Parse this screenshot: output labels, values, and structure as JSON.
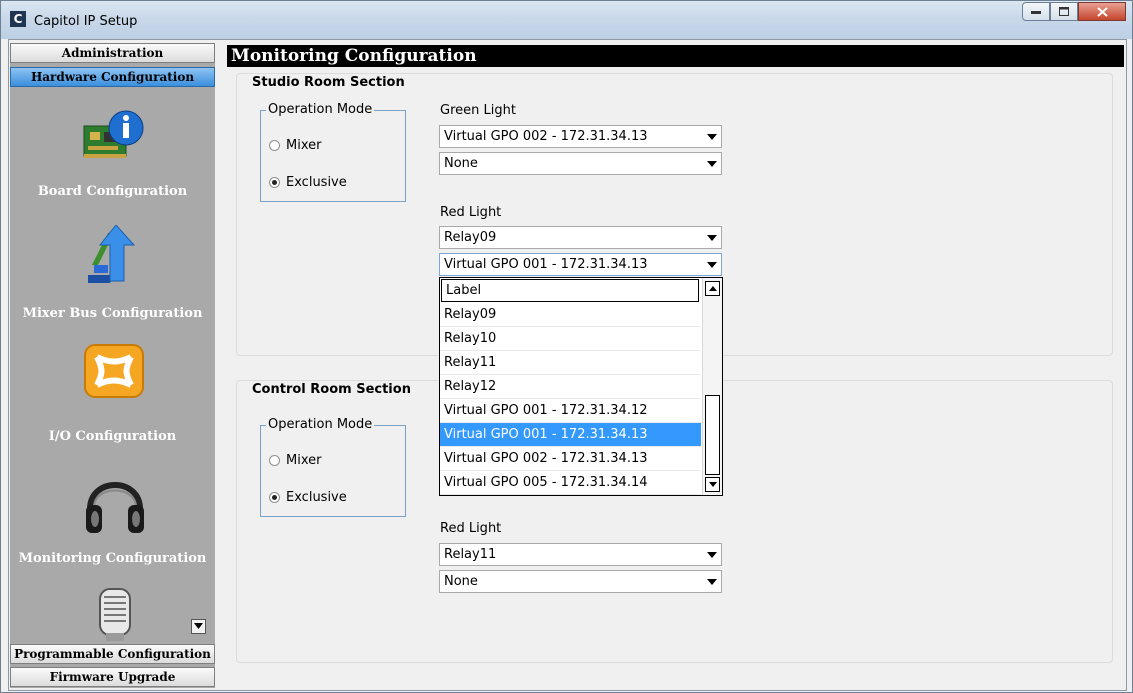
{
  "window": {
    "title": "Capitol IP Setup",
    "icon": "C"
  },
  "sidebar": {
    "top_buttons": [
      {
        "label": "Administration"
      },
      {
        "label": "Hardware Configuration"
      }
    ],
    "items": [
      {
        "label": "Board Configuration",
        "icon": "board-icon"
      },
      {
        "label": "Mixer Bus Configuration",
        "icon": "mixer-bus-icon"
      },
      {
        "label": "I/O Configuration",
        "icon": "io-icon"
      },
      {
        "label": "Monitoring Configuration",
        "icon": "headphones-icon"
      },
      {
        "label": "",
        "icon": "microphone-icon"
      }
    ],
    "bottom_buttons": [
      {
        "label": "Programmable Configuration"
      },
      {
        "label": "Firmware Upgrade"
      }
    ]
  },
  "main": {
    "title": "Monitoring Configuration",
    "studio": {
      "title": "Studio Room Section",
      "operation_mode": {
        "title": "Operation Mode",
        "mixer": "Mixer",
        "exclusive": "Exclusive",
        "selected": "Exclusive"
      },
      "green_light": {
        "label": "Green Light",
        "value1": "Virtual GPO 002 - 172.31.34.13",
        "value2": "None"
      },
      "red_light": {
        "label": "Red Light",
        "value1": "Relay09",
        "value2": "Virtual GPO 001 - 172.31.34.13"
      }
    },
    "control": {
      "title": "Control Room Section",
      "operation_mode": {
        "title": "Operation Mode",
        "mixer": "Mixer",
        "exclusive": "Exclusive",
        "selected": "Exclusive"
      },
      "red_light": {
        "label": "Red Light",
        "value1": "Relay11",
        "value2": "None"
      }
    },
    "dropdown": {
      "options": [
        "Label",
        "Relay09",
        "Relay10",
        "Relay11",
        "Relay12",
        "Virtual GPO 001 - 172.31.34.12",
        "Virtual GPO 001 - 172.31.34.13",
        "Virtual GPO 002 - 172.31.34.13",
        "Virtual GPO 005 - 172.31.34.14"
      ],
      "selected": "Virtual GPO 001 - 172.31.34.13"
    }
  }
}
